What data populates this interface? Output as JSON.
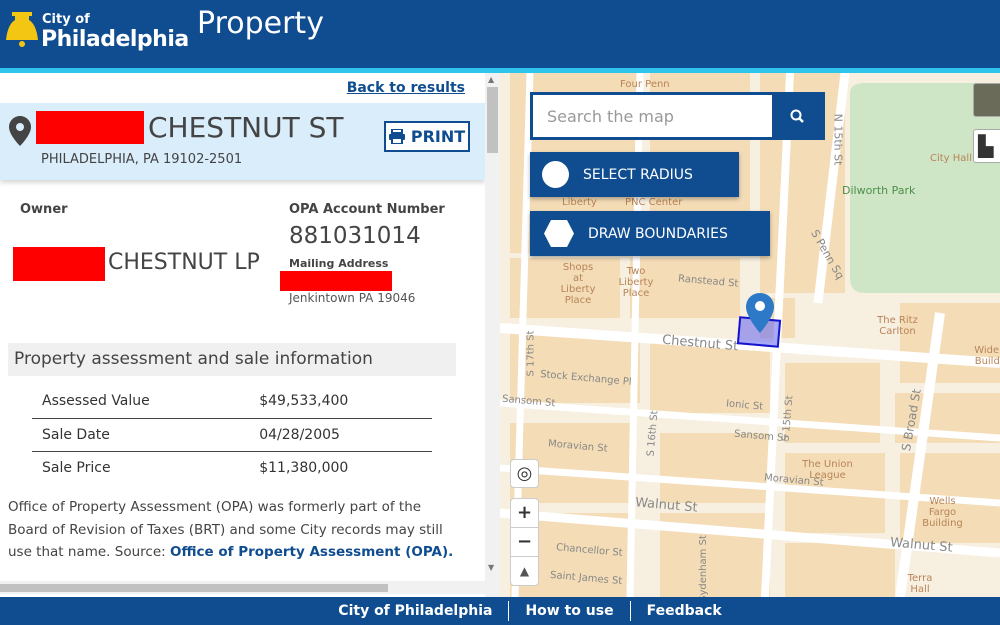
{
  "header": {
    "logo_line1": "City of",
    "logo_line2": "Philadelphia",
    "app_title": "Property"
  },
  "colors": {
    "brand": "#0f4d90",
    "accent": "#2fc4ec",
    "highlight_bg": "#daedfa"
  },
  "property": {
    "back_label": "Back to results",
    "street": "CHESTNUT ST",
    "city_line": "PHILADELPHIA, PA 19102-2501",
    "print_label": "PRINT",
    "owner_label": "Owner",
    "owner_name": "CHESTNUT LP",
    "opa_label": "OPA Account Number",
    "opa_number": "881031014",
    "mailing_label": "Mailing Address",
    "mailing_city": "Jenkintown PA 19046"
  },
  "assessment": {
    "title": "Property assessment and sale information",
    "rows": [
      {
        "label": "Assessed Value",
        "value": "$49,533,400"
      },
      {
        "label": "Sale Date",
        "value": "04/28/2005"
      },
      {
        "label": "Sale Price",
        "value": "$11,380,000"
      }
    ],
    "note": "Office of Property Assessment (OPA) was formerly part of the Board of Revision of Taxes (BRT) and some City records may still use that name. Source: ",
    "note_link": "Office of Property Assessment (OPA)."
  },
  "map": {
    "search_placeholder": "Search the map",
    "select_radius": "SELECT RADIUS",
    "draw_boundaries": "DRAW BOUNDARIES",
    "places": [
      "Four Penn",
      "City Hall",
      "Dilworth Park",
      "Shops at Liberty Place",
      "Two Liberty Place",
      "The Ritz Carlton",
      "Widener Building",
      "The Union League",
      "Wells Fargo Building",
      "Terra Hall",
      "Liberty",
      "PNC Center"
    ],
    "streets": [
      "Ranstead St",
      "Chestnut St",
      "S 17th St",
      "Stock Exchange Pl",
      "Sansom St",
      "Ionic St",
      "S 15th St",
      "S 16th St",
      "Sansom St",
      "Moravian St",
      "Moravian St",
      "Walnut St",
      "Walnut St",
      "Chancellor St",
      "Saint James St",
      "S Broad St",
      "S Penn Sq",
      "N 15th St",
      "Sydenham St"
    ]
  },
  "footer": {
    "links": [
      "City of Philadelphia",
      "How to use",
      "Feedback"
    ]
  }
}
